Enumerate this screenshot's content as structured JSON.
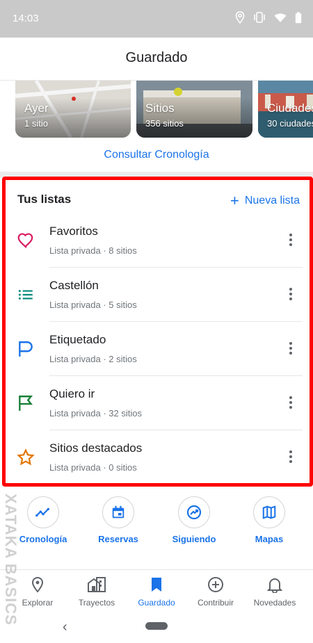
{
  "status_bar": {
    "time": "14:03"
  },
  "app_bar": {
    "title": "Guardado"
  },
  "cards": [
    {
      "name": "Ayer",
      "count": "1 sitio"
    },
    {
      "name": "Sitios",
      "count": "356 sitios"
    },
    {
      "name": "Ciudades",
      "count": "30 ciudades"
    }
  ],
  "timeline_link": "Consultar Cronología",
  "lists": {
    "title": "Tus listas",
    "new_list": "Nueva lista",
    "items": [
      {
        "name": "Favoritos",
        "meta": "Lista privada · 8 sitios",
        "icon": "heart-icon",
        "color": "#d81b60"
      },
      {
        "name": "Castellón",
        "meta": "Lista privada · 5 sitios",
        "icon": "list-icon",
        "color": "#00897b"
      },
      {
        "name": "Etiquetado",
        "meta": "Lista privada · 2 sitios",
        "icon": "flag-outline-icon",
        "color": "#1a73e8"
      },
      {
        "name": "Quiero ir",
        "meta": "Lista privada · 32 sitios",
        "icon": "flag-icon",
        "color": "#188038"
      },
      {
        "name": "Sitios destacados",
        "meta": "Lista privada · 0 sitios",
        "icon": "star-icon",
        "color": "#e37400"
      }
    ]
  },
  "actions": [
    {
      "label": "Cronología",
      "icon": "timeline-icon"
    },
    {
      "label": "Reservas",
      "icon": "calendar-icon"
    },
    {
      "label": "Siguiendo",
      "icon": "following-icon"
    },
    {
      "label": "Mapas",
      "icon": "map-icon"
    }
  ],
  "bottom_nav": [
    {
      "label": "Explorar",
      "icon": "location-pin-icon"
    },
    {
      "label": "Trayectos",
      "icon": "commute-icon"
    },
    {
      "label": "Guardado",
      "icon": "bookmark-icon",
      "active": true
    },
    {
      "label": "Contribuir",
      "icon": "add-circle-icon"
    },
    {
      "label": "Novedades",
      "icon": "bell-icon"
    }
  ],
  "watermark": "XATAKA BASICS",
  "colors": {
    "accent": "#1a73e8",
    "highlight_border": "#ff0000"
  }
}
